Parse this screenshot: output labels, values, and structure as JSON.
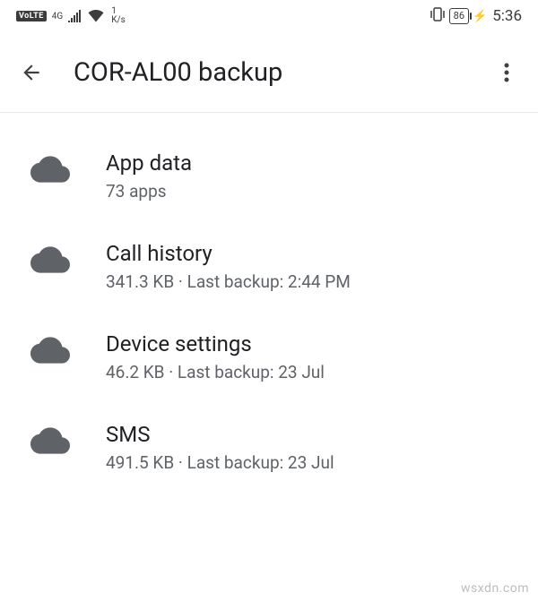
{
  "status_bar": {
    "volte": "VoLTE",
    "fourg": "4G",
    "speed_value": "1",
    "speed_unit": "K/s",
    "battery": "86",
    "charge_glyph": "⚡",
    "time": "5:36"
  },
  "app_bar": {
    "title": "COR-AL00 backup"
  },
  "items": [
    {
      "title": "App data",
      "subtitle": "73 apps"
    },
    {
      "title": "Call history",
      "subtitle": "341.3 KB · Last backup: 2:44 PM"
    },
    {
      "title": "Device settings",
      "subtitle": "46.2 KB · Last backup: 23 Jul"
    },
    {
      "title": "SMS",
      "subtitle": "491.5 KB · Last backup: 23 Jul"
    }
  ],
  "watermark": "wsxdn.com"
}
